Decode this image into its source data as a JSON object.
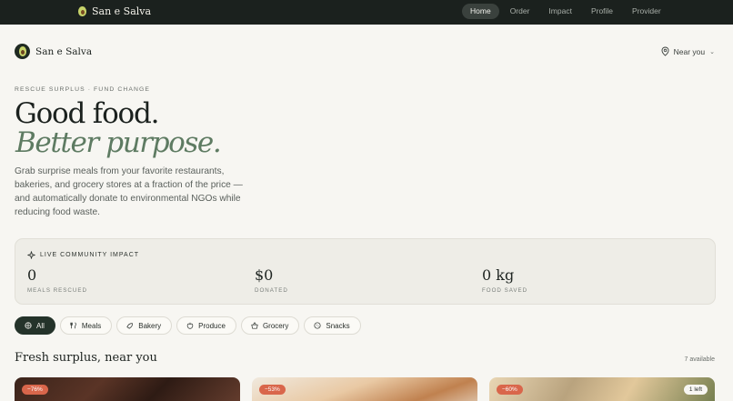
{
  "topbar": {
    "brand": "San e Salva",
    "nav": [
      "Home",
      "Order",
      "Impact",
      "Profile",
      "Provider"
    ],
    "active_nav": "Home"
  },
  "header": {
    "brand": "San e Salva",
    "location": "Near you"
  },
  "hero": {
    "eyebrow": "RESCUE SURPLUS · FUND CHANGE",
    "title_line1": "Good food.",
    "title_line2": "Better purpose.",
    "intro": "Grab surprise meals from your favorite restaurants, bakeries, and grocery stores at a fraction of the price — and automatically donate to environmental NGOs while reducing food waste."
  },
  "impact": {
    "title": "LIVE COMMUNITY IMPACT",
    "stats": [
      {
        "value": "0",
        "label": "MEALS RESCUED"
      },
      {
        "value": "$0",
        "label": "DONATED"
      },
      {
        "value": "0 kg",
        "label": "FOOD SAVED"
      }
    ]
  },
  "filters": {
    "chips": [
      {
        "label": "All",
        "icon": "grid-icon",
        "active": true
      },
      {
        "label": "Meals",
        "icon": "utensils-icon",
        "active": false
      },
      {
        "label": "Bakery",
        "icon": "croissant-icon",
        "active": false
      },
      {
        "label": "Produce",
        "icon": "apple-icon",
        "active": false
      },
      {
        "label": "Grocery",
        "icon": "basket-icon",
        "active": false
      },
      {
        "label": "Snacks",
        "icon": "cookie-icon",
        "active": false
      }
    ]
  },
  "section": {
    "title": "Fresh surplus, near you",
    "available": "7 available"
  },
  "cards": [
    {
      "discount": "−76%"
    },
    {
      "discount": "−53%"
    },
    {
      "discount": "−60%",
      "left": "1 left"
    }
  ],
  "colors": {
    "topbar": "#1b211e",
    "accent_green": "#5e7b62",
    "chip_active": "#24332a",
    "badge": "#d9664b"
  }
}
